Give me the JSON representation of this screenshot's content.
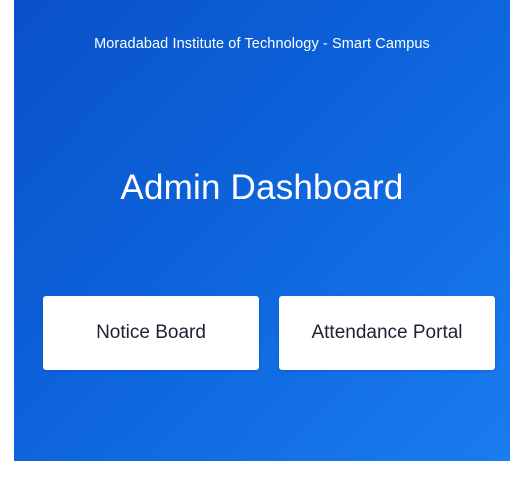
{
  "header": {
    "institute": "Moradabad Institute of Technology - Smart Campus"
  },
  "main": {
    "title": "Admin Dashboard",
    "buttons": [
      {
        "label": "Notice Board"
      },
      {
        "label": "Attendance Portal"
      }
    ]
  },
  "colors": {
    "background_start": "#0a51c9",
    "background_end": "#1a7cf0",
    "button_background": "#ffffff",
    "button_text": "#1b2230",
    "title_text": "#ffffff"
  }
}
